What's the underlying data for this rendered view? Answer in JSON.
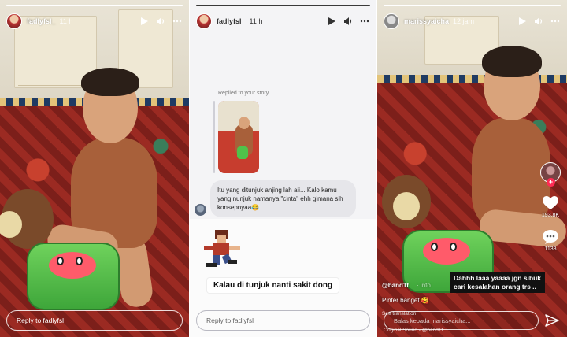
{
  "panels": [
    {
      "username": "fadlyfsl_",
      "time": "11 h",
      "reply_placeholder": "Reply to fadlyfsl_",
      "progress": 1.0
    },
    {
      "username": "fadlyfsl_",
      "time": "11 h",
      "replied_label": "Replied to your story",
      "message": "Itu yang ditunjuk anjing lah aii... Kalo kamu yang nunjuk namanya \"cinta\" ehh gimana sih konsepnyaa😂",
      "sticker_caption": "Kalau di tunjuk nanti sakit dong",
      "reply_placeholder": "Reply to fadlyfsl_",
      "progress": 1.0
    },
    {
      "username": "marissyaicha",
      "time": "12 jam",
      "likes": "193.8K",
      "comments": "1138",
      "tt_username": "@band1t",
      "tt_username_faint": "· info",
      "caption": "Pinter banget 🥰",
      "see_translation": "See translation",
      "overlay_line1": "Dahhh laaa yaaaa jgn sibuk",
      "overlay_line2": "cari kesalahan orang trs ..",
      "sound": "Original Sound - @band1t",
      "reply_placeholder": "Balas kepada marissyaicha...",
      "progress": 1.0
    }
  ],
  "icons": {
    "play": "play-icon",
    "volume": "volume-icon",
    "more": "more-icon",
    "heart": "heart-icon",
    "comment": "comment-icon",
    "send": "send-icon"
  },
  "colors": {
    "tiktok_plus": "#fe2c55",
    "rug_red": "#9b2a22",
    "toy_green": "#3ea63a"
  }
}
